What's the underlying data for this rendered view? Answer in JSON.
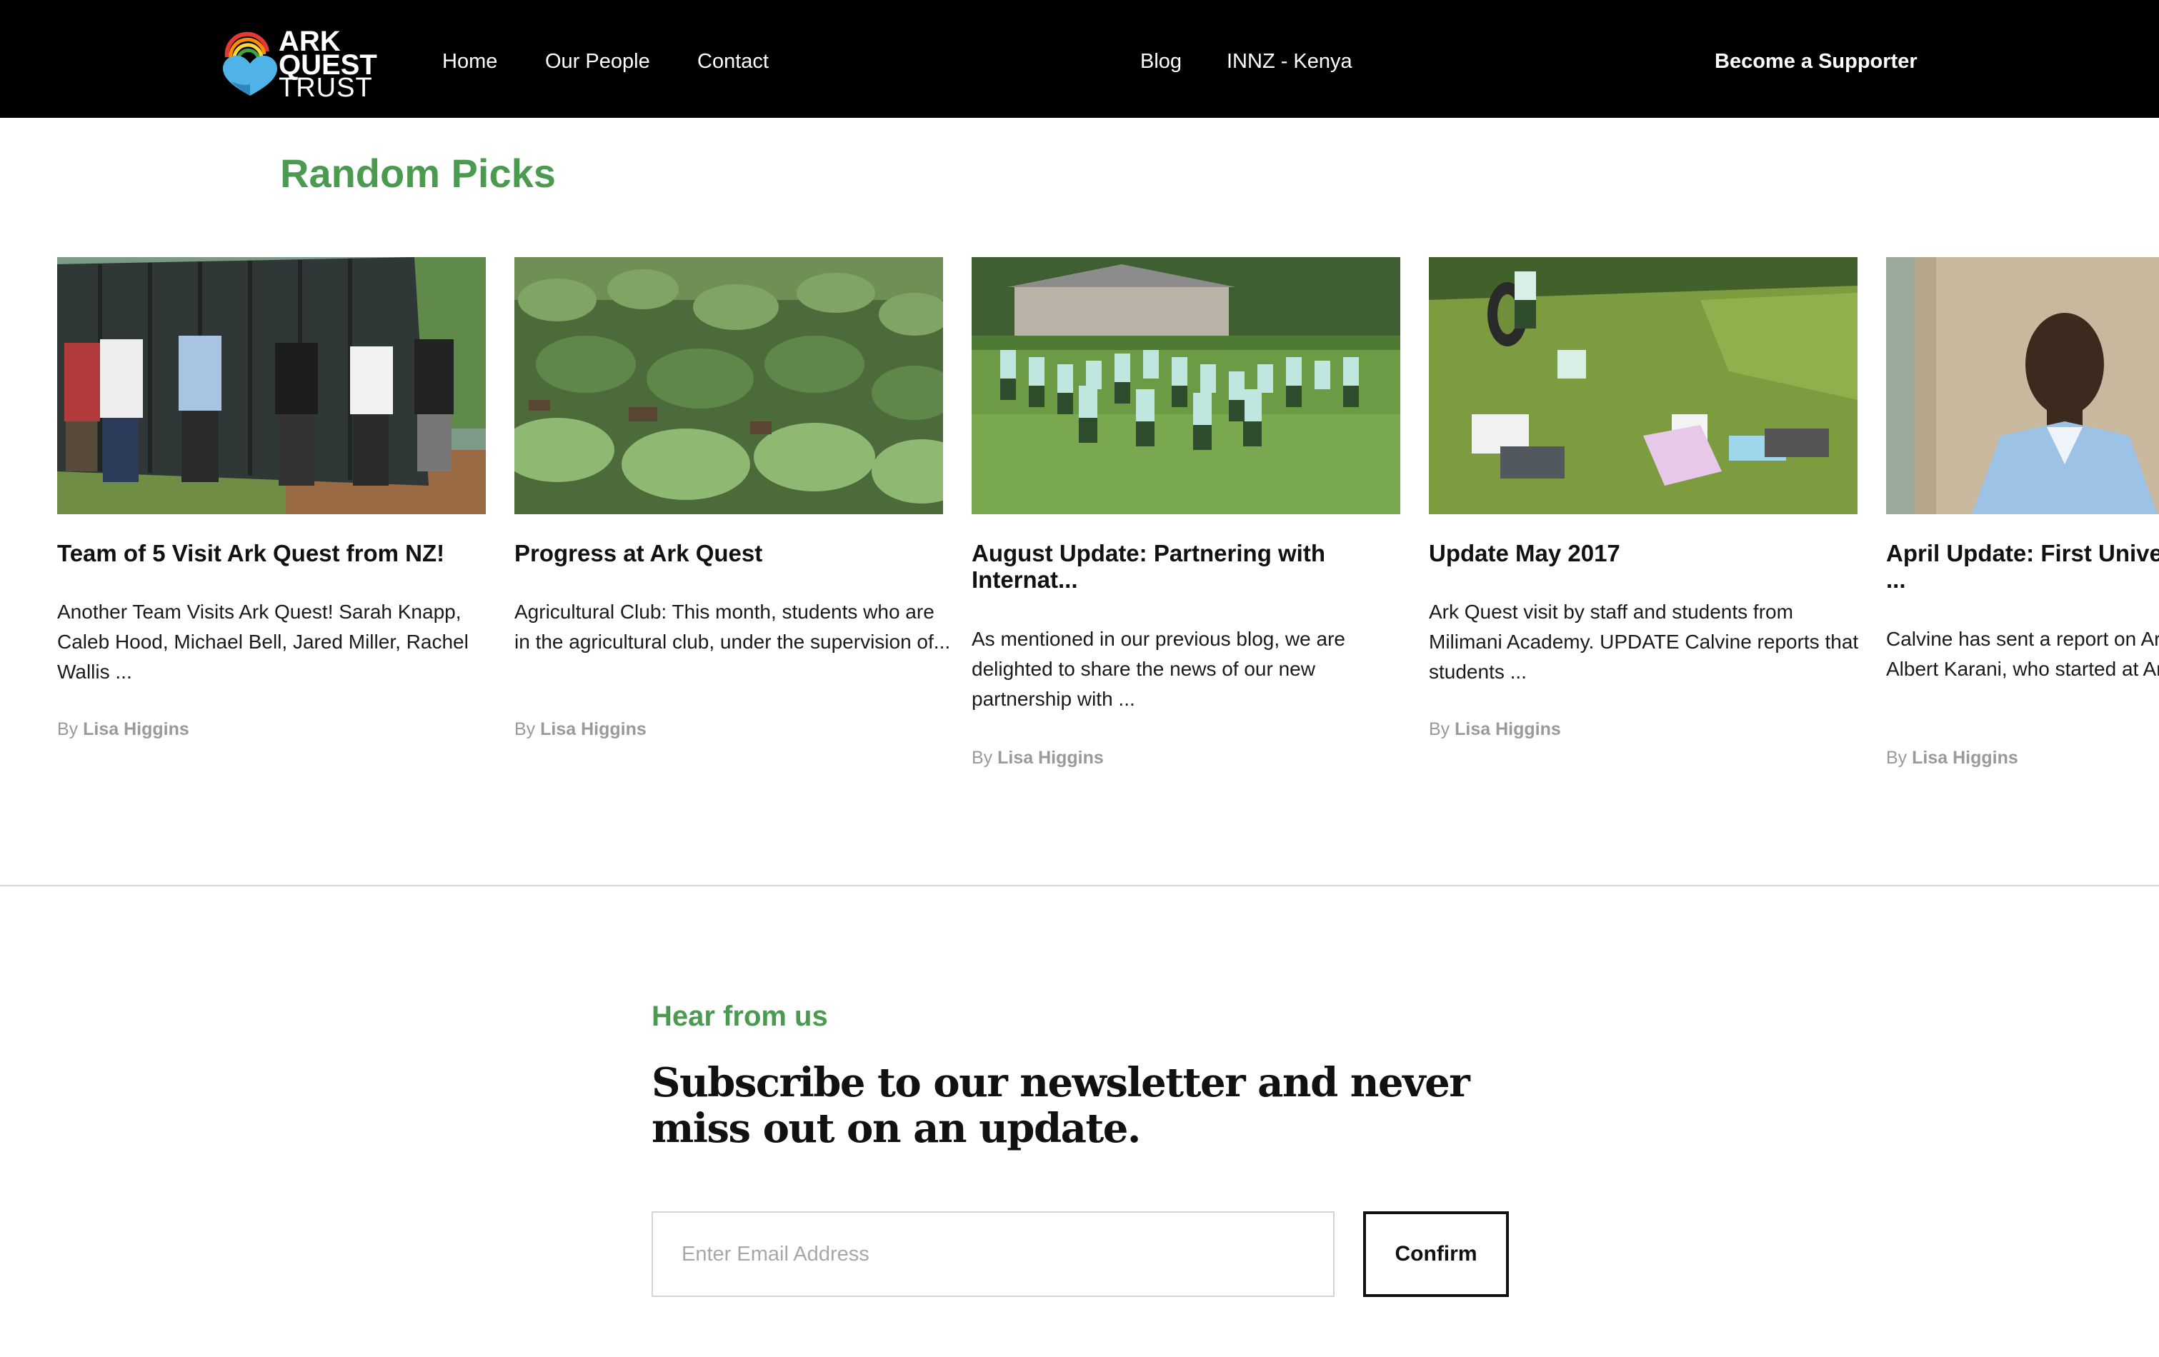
{
  "header": {
    "logo": {
      "line1": "ARK",
      "line2": "QUEST",
      "line3": "TRUST"
    },
    "nav_left": [
      "Home",
      "Our People",
      "Contact"
    ],
    "nav_center": [
      "Blog",
      "INNZ - Kenya"
    ],
    "cta": "Become a Supporter"
  },
  "random_picks": {
    "title": "Random Picks",
    "cards": [
      {
        "title": "Team of 5 Visit Ark Quest from NZ!",
        "excerpt": "Another Team Visits Ark Quest! Sarah Knapp, Caleb Hood, Michael Bell, Jared Miller, Rachel Wallis ...",
        "by": "By",
        "author": "Lisa Higgins"
      },
      {
        "title": "Progress at Ark Quest",
        "excerpt": "Agricultural Club: This month, students who are in the agricultural club, under the supervision of...",
        "by": "By",
        "author": "Lisa Higgins"
      },
      {
        "title": "August Update: Partnering with Internat...",
        "excerpt": "As mentioned in our previous blog, we are delighted to share the news of our new partnership with ...",
        "by": "By",
        "author": "Lisa Higgins"
      },
      {
        "title": "Update May 2017",
        "excerpt": "Ark Quest visit by staff and students from Milimani Academy. UPDATE Calvine reports that students ...",
        "by": "By",
        "author": "Lisa Higgins"
      },
      {
        "title": "April Update: First University Student ...",
        "excerpt": "Calvine has sent a report on Ark Quest student, Albert Karani, who started at Ark Que...",
        "by": "By",
        "author": "Lisa Higgins"
      }
    ]
  },
  "newsletter": {
    "eyebrow": "Hear from us",
    "headline": "Subscribe to our newsletter and never miss out on an update.",
    "email_placeholder": "Enter Email Address",
    "email_value": "",
    "confirm_label": "Confirm"
  },
  "colors": {
    "accent_green": "#4a9a4f",
    "header_bg": "#000000"
  }
}
